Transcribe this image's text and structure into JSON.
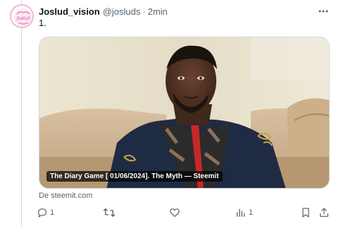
{
  "post": {
    "display_name": "Joslud_vision",
    "handle": "@josluds",
    "separator": "·",
    "time": "2min",
    "text": "1.",
    "avatar_text": "Joslud"
  },
  "card": {
    "title": "The Diary Game [ 01/06/2024]. The Myth — Steemit",
    "source": "De steemit.com"
  },
  "actions": {
    "reply_count": "1",
    "repost_count": "",
    "like_count": "",
    "views_count": "1"
  },
  "icons": {
    "more": "more-icon",
    "reply": "reply-icon",
    "repost": "repost-icon",
    "like": "like-icon",
    "views": "views-icon",
    "bookmark": "bookmark-icon",
    "share": "share-icon"
  },
  "colors": {
    "text_primary": "#0f1419",
    "text_secondary": "#536471",
    "border": "#cfd9de"
  }
}
